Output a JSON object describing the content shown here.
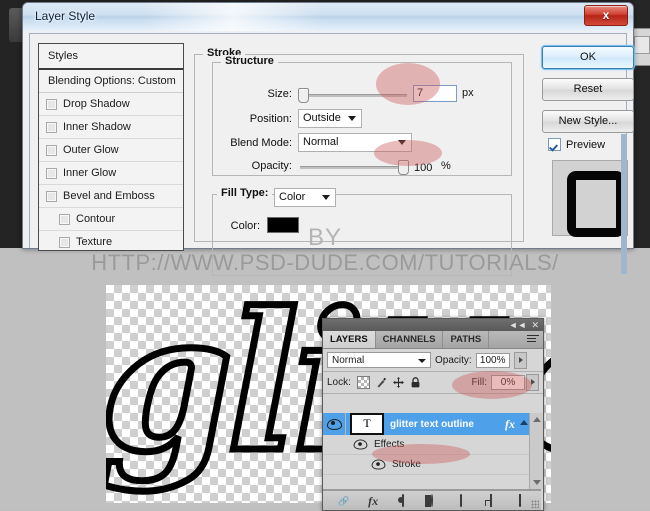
{
  "dialog": {
    "title": "Layer Style",
    "close_label": "x",
    "styles_panel": {
      "header": "Styles",
      "blending_options": "Blending Options: Custom",
      "items": [
        {
          "label": "Drop Shadow",
          "checked": false,
          "indent": false
        },
        {
          "label": "Inner Shadow",
          "checked": false,
          "indent": false
        },
        {
          "label": "Outer Glow",
          "checked": false,
          "indent": false
        },
        {
          "label": "Inner Glow",
          "checked": false,
          "indent": false
        },
        {
          "label": "Bevel and Emboss",
          "checked": false,
          "indent": false
        },
        {
          "label": "Contour",
          "checked": false,
          "indent": true
        },
        {
          "label": "Texture",
          "checked": false,
          "indent": true
        }
      ]
    },
    "stroke": {
      "group_label": "Stroke",
      "structure_label": "Structure",
      "size_label": "Size:",
      "size_value": "7",
      "size_unit": "px",
      "position_label": "Position:",
      "position_value": "Outside",
      "blend_mode_label": "Blend Mode:",
      "blend_mode_value": "Normal",
      "opacity_label": "Opacity:",
      "opacity_value": "100",
      "opacity_unit": "%",
      "fill_type_label": "Fill Type:",
      "fill_type_value": "Color",
      "color_label": "Color:",
      "color_value": "#000000"
    },
    "buttons": {
      "ok": "OK",
      "reset": "Reset",
      "new_style": "New Style...",
      "preview": "Preview",
      "preview_checked": true
    }
  },
  "watermark": {
    "by": "BY",
    "url": "HTTP://WWW.PSD-DUDE.COM/TUTORIALS/"
  },
  "canvas": {
    "artwork_text": "glitte"
  },
  "layers_panel": {
    "tabs": [
      {
        "label": "LAYERS",
        "active": true
      },
      {
        "label": "CHANNELS",
        "active": false
      },
      {
        "label": "PATHS",
        "active": false
      }
    ],
    "collapse_glyph": "◄◄",
    "close_glyph": "✕",
    "blend_mode": "Normal",
    "opacity_label": "Opacity:",
    "opacity_value": "100%",
    "lock_label": "Lock:",
    "fill_label": "Fill:",
    "fill_value": "0%",
    "layer": {
      "thumb_glyph": "T",
      "name": "glitter text outline",
      "fx_glyph": "fx",
      "effects_label": "Effects",
      "effect_items": [
        "Stroke"
      ]
    },
    "bottom_icons": [
      "link-icon",
      "fx-icon",
      "mask-icon",
      "adjustment-icon",
      "group-icon",
      "new-layer-icon",
      "delete-icon"
    ]
  },
  "colors": {
    "accent_blue": "#4ea0e8",
    "highlight_red": "#cd5c5c",
    "backdrop_dark": "#262626",
    "backdrop_gray": "#c0c0c0"
  }
}
